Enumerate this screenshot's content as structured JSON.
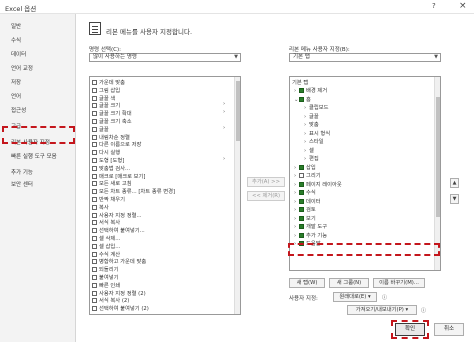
{
  "window": {
    "title": "Excel 옵션",
    "help_icon": "question-icon",
    "close_icon": "close-icon"
  },
  "sidebar": {
    "items": [
      "일반",
      "수식",
      "데이터",
      "언어 교정",
      "저장",
      "언어",
      "접근성",
      "고급",
      "리본 사용자 지정",
      "빠른 실행 도구 모음",
      "추가 기능",
      "보안 센터"
    ],
    "selected_index": 8
  },
  "header": {
    "text": "리본 메뉴를 사용자 지정합니다."
  },
  "left": {
    "choose_label": "명령 선택(C):",
    "choose_value": "많이 사용하는 명령",
    "commands": [
      "가운데 맞춤",
      "그림 삽입",
      "글꼴 색",
      "글꼴 크기",
      "글꼴 크기 확대",
      "글꼴 크기 축소",
      "글꼴",
      "내림차순 정렬",
      "다른 이름으로 저장",
      "다시 실행",
      "도형 [도형]",
      "맞춤법 검사...",
      "매크로 [매크로 보기]",
      "모든 새로 고침",
      "모든 차트 종류... [차트 종류 변경]",
      "반짝 채우기",
      "복사",
      "사용자 지정 정렬...",
      "서식 복사",
      "선택하여 붙여넣기...",
      "셀 삭제...",
      "셀 삽입...",
      "수식 계산",
      "병합하고 가운데 맞춤",
      "되돌리기",
      "붙여넣기",
      "빠른 인쇄",
      "사용자 지정 정렬 (2)",
      "서식 복사 (2)",
      "선택하여 붙여넣기 (2)"
    ],
    "chevron_rows": [
      3,
      4,
      6,
      10
    ]
  },
  "middle": {
    "add_button": "추가(A) >>",
    "remove_button": "<< 제거(R)"
  },
  "right": {
    "customize_label": "리본 메뉴 사용자 지정(B):",
    "customize_value": "기본 탭",
    "tree_header": "기본 탭",
    "tree": [
      {
        "label": "배경 제거",
        "level": 1,
        "toggle": "+",
        "checked": true
      },
      {
        "label": "홈",
        "level": 1,
        "toggle": "-",
        "checked": true
      },
      {
        "label": "클립보드",
        "level": 2,
        "toggle": "+",
        "checked": null
      },
      {
        "label": "글꼴",
        "level": 2,
        "toggle": "+",
        "checked": null
      },
      {
        "label": "맞춤",
        "level": 2,
        "toggle": "+",
        "checked": null
      },
      {
        "label": "표시 형식",
        "level": 2,
        "toggle": "+",
        "checked": null
      },
      {
        "label": "스타일",
        "level": 2,
        "toggle": "+",
        "checked": null
      },
      {
        "label": "셀",
        "level": 2,
        "toggle": "+",
        "checked": null
      },
      {
        "label": "편집",
        "level": 2,
        "toggle": "+",
        "checked": null
      },
      {
        "label": "삽입",
        "level": 1,
        "toggle": "+",
        "checked": true
      },
      {
        "label": "그리기",
        "level": 1,
        "toggle": "+",
        "checked": false
      },
      {
        "label": "페이지 레이아웃",
        "level": 1,
        "toggle": "+",
        "checked": true
      },
      {
        "label": "수식",
        "level": 1,
        "toggle": "+",
        "checked": true
      },
      {
        "label": "데이터",
        "level": 1,
        "toggle": "+",
        "checked": true
      },
      {
        "label": "검토",
        "level": 1,
        "toggle": "+",
        "checked": true
      },
      {
        "label": "보기",
        "level": 1,
        "toggle": "+",
        "checked": true
      },
      {
        "label": "개발 도구",
        "level": 1,
        "toggle": "+",
        "checked": true
      },
      {
        "label": "추가 기능",
        "level": 1,
        "toggle": "+",
        "checked": true
      },
      {
        "label": "도움말",
        "level": 1,
        "toggle": "+",
        "checked": true
      }
    ],
    "new_tab_button": "새 탭(W)",
    "new_group_button": "새 그룹(N)",
    "rename_button": "이름 바꾸기(M)...",
    "custom_label": "사용자 지정:",
    "reset_value": "원래대로(E) ▾",
    "import_export_value": "가져오기/내보내기(P) ▾",
    "up_icon": "up-arrow-icon",
    "down_icon": "down-arrow-icon"
  },
  "footer": {
    "ok_button": "확인",
    "cancel_button": "취소"
  },
  "colors": {
    "highlight": "#c4161c",
    "checkbox": "#2a7d2a"
  }
}
